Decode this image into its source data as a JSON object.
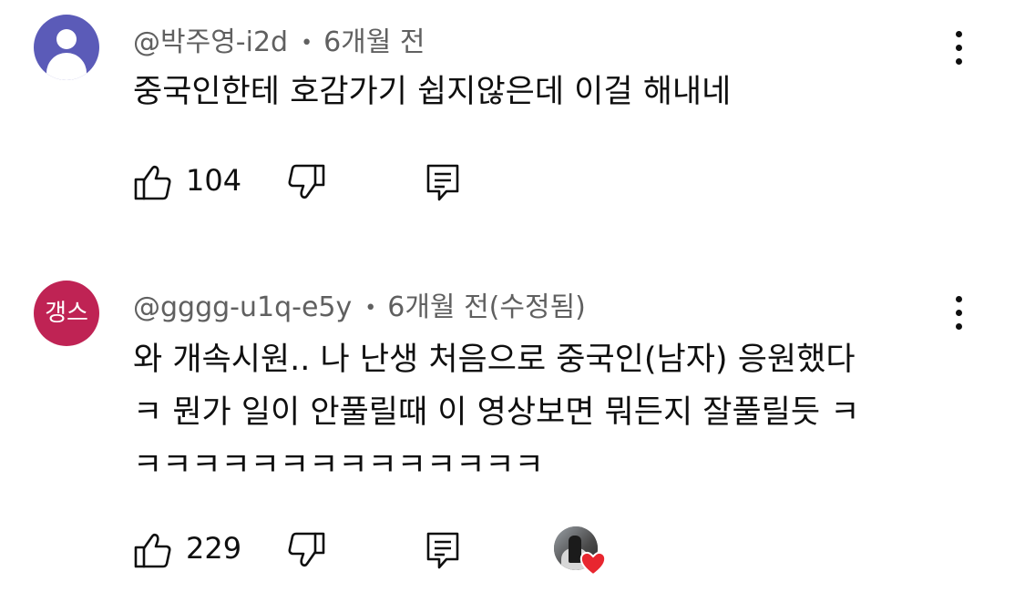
{
  "comments": [
    {
      "author": "@박주영-i2d",
      "separator": "•",
      "time": "6개월 전",
      "avatar": {
        "type": "default-person",
        "color": "#5b5bb8"
      },
      "lines": [
        "중국인한테 호감가기 쉽지않은데 이걸 해내네"
      ],
      "likes": "104",
      "has_creator_heart": false
    },
    {
      "author": "@gggg-u1q-e5y",
      "separator": "•",
      "time": "6개월 전(수정됨)",
      "avatar": {
        "type": "text",
        "text": "갱스",
        "color": "#bf2354"
      },
      "lines": [
        "와 개속시원.. 나 난생 처음으로 중국인(남자) 응원했다",
        "ㅋ 뭔가 일이 안풀릴때 이 영상보면 뭐든지 잘풀릴듯 ㅋ",
        "ㅋㅋㅋㅋㅋㅋㅋㅋㅋㅋㅋㅋㅋㅋ"
      ],
      "likes": "229",
      "has_creator_heart": true
    }
  ],
  "icons": {
    "like": "thumbs-up-icon",
    "dislike": "thumbs-down-icon",
    "reply": "reply-icon",
    "menu": "more-vertical-icon",
    "creator_heart": "heart-icon"
  },
  "colors": {
    "text": "#0f0f0f",
    "meta": "#606060",
    "heart": "#e8262f"
  }
}
